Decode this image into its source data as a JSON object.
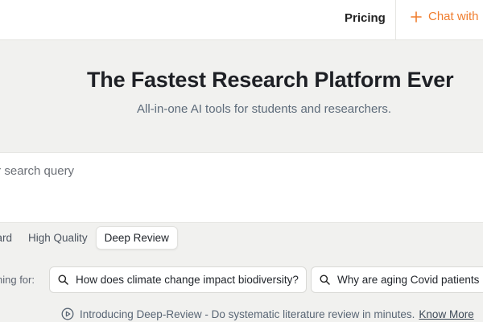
{
  "nav": {
    "pricing_label": "Pricing",
    "chat_label": "Chat with"
  },
  "hero": {
    "title": "The Fastest Research Platform Ever",
    "subtitle": "All-in-one AI tools for students and researchers."
  },
  "search": {
    "placeholder": "your search query"
  },
  "modes": {
    "tabs": [
      {
        "label": "dard"
      },
      {
        "label": "High Quality"
      },
      {
        "label": "Deep Review"
      }
    ],
    "active": "Deep Review"
  },
  "suggestions": {
    "label": "ning for:",
    "items": [
      {
        "text": "How does climate change impact biodiversity?"
      },
      {
        "text": "Why are aging Covid patients m"
      }
    ]
  },
  "intro": {
    "text": "Introducing Deep-Review - Do systematic literature review in minutes.",
    "link_label": "Know More"
  },
  "colors": {
    "accent": "#f07d2d",
    "background": "#f1f1ef",
    "panel": "#ffffff"
  }
}
